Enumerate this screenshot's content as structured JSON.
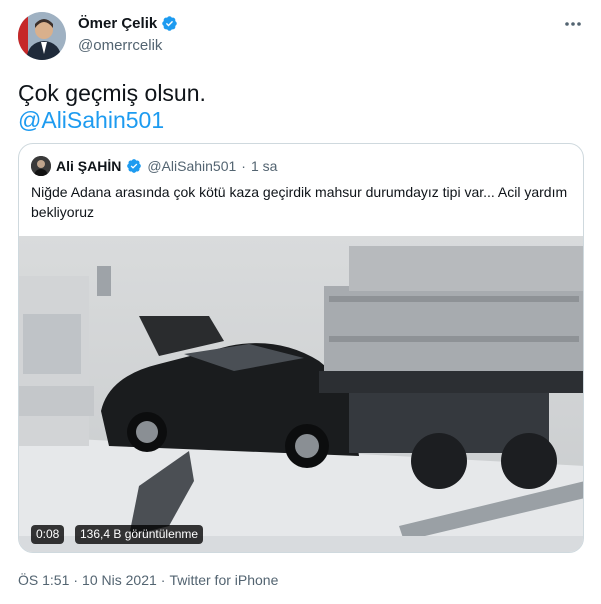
{
  "author": {
    "name": "Ömer Çelik",
    "handle": "@omerrcelik",
    "verified_icon": "verified-badge-icon",
    "more_icon": "more-horizontal-icon"
  },
  "tweet": {
    "line1": "Çok geçmiş olsun.",
    "mention": "@AliSahin501"
  },
  "quote": {
    "name": "Ali ŞAHİN",
    "handle": "@AliSahin501",
    "separator": "·",
    "time": "1 sa",
    "text": "Niğde Adana arasında çok kötü kaza geçirdik mahsur durumdayız tipi var... Acil yardım bekliyoruz",
    "video": {
      "duration": "0:08",
      "views": "136,4 B görüntülenme"
    }
  },
  "meta": {
    "time": "ÖS 1:51",
    "dot1": "·",
    "date": "10 Nis 2021",
    "dot2": "·",
    "source": "Twitter for iPhone"
  },
  "colors": {
    "accent": "#1d9bf0",
    "text": "#0f1419",
    "secondary": "#536471",
    "border": "#cfd9de"
  }
}
